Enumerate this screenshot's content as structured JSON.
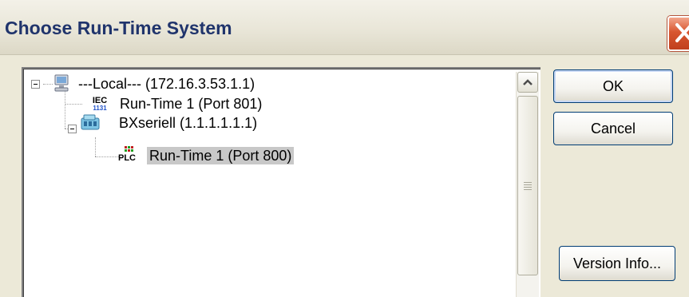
{
  "window": {
    "title": "Choose Run-Time System"
  },
  "tree": {
    "nodes": [
      {
        "label": "---Local---   (172.16.3.53.1.1)",
        "icon": "computer-icon",
        "level": 0,
        "expanded": true
      },
      {
        "label": "Run-Time 1 (Port 801)",
        "icon": "iec-1131-icon",
        "icon_top": "IEC",
        "icon_bottom": "1131",
        "level": 1
      },
      {
        "label": "BXseriell   (1.1.1.1.1.1)",
        "icon": "bus-terminal-icon",
        "level": 1,
        "expanded": true
      },
      {
        "label": "Run-Time 1 (Port 800)",
        "icon": "plc-icon",
        "icon_text": "PLC",
        "level": 2,
        "selected": true
      }
    ]
  },
  "buttons": {
    "ok": "OK",
    "cancel": "Cancel",
    "version_info": "Version Info..."
  },
  "colors": {
    "title_text": "#20346c",
    "selection": "#c8c8c8",
    "close_button": "#d8562f",
    "button_border": "#003c74"
  }
}
